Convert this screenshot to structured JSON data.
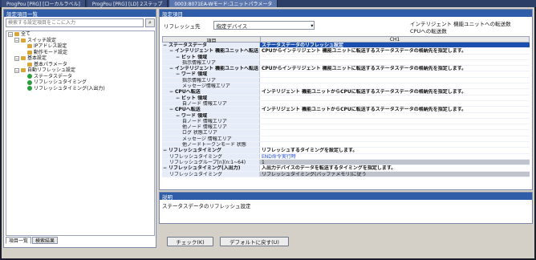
{
  "tabs": [
    {
      "label": "ProgPou [PRG] [ローカルラベル]"
    },
    {
      "label": "ProgPou [PRG] [LD] 2ステップ"
    },
    {
      "label": "0003:8071EA-Wモード:ユニットパラメータ"
    }
  ],
  "left": {
    "title": "設定項目一覧",
    "search_placeholder": "検索する設定項目をここに入力",
    "tree": [
      {
        "indent": 0,
        "toggle": "−",
        "icon": "gear",
        "label": "全て"
      },
      {
        "indent": 1,
        "toggle": "−",
        "icon": "folder",
        "label": "スイッチ設定"
      },
      {
        "indent": 2,
        "toggle": "",
        "icon": "folder",
        "label": "IPアドレス設定"
      },
      {
        "indent": 2,
        "toggle": "",
        "icon": "folder",
        "label": "動作モード設定"
      },
      {
        "indent": 1,
        "toggle": "−",
        "icon": "folder",
        "label": "基本設定"
      },
      {
        "indent": 2,
        "toggle": "",
        "icon": "folder",
        "label": "基本パラメータ"
      },
      {
        "indent": 1,
        "toggle": "−",
        "icon": "folder",
        "label": "自動リフレッシュ設定"
      },
      {
        "indent": 2,
        "toggle": "",
        "icon": "green",
        "label": "ステータスデータ"
      },
      {
        "indent": 2,
        "toggle": "",
        "icon": "green",
        "label": "リフレッシュタイミング"
      },
      {
        "indent": 2,
        "toggle": "",
        "icon": "green",
        "label": "リフレッシュタイミング(入出力)"
      }
    ],
    "tabs": [
      "項目一覧",
      "検索結果"
    ]
  },
  "right": {
    "title": "設定項目",
    "refresh_label": "リフレッシュ先",
    "refresh_value": "指定デバイス",
    "info1": "インテリジェント 機能ユニットへの転送数",
    "info2": "CPUへの転送数",
    "col_item": "項目",
    "col_ch": "CH1",
    "rows": [
      {
        "indent": 0,
        "toggle": "−",
        "item": "ステータスデータ",
        "value": "ステータスデータのリフレッシュ設定",
        "style": "selected",
        "bold": true
      },
      {
        "indent": 1,
        "toggle": "−",
        "item": "インテリジェント 機能ユニットへ転送",
        "value": "CPUからインテリジェント 機能ユニットに転送するステータスデータの格納先を指定します。",
        "style": "",
        "bold": true
      },
      {
        "indent": 2,
        "toggle": "−",
        "item": "ビット 領域",
        "value": "",
        "style": "",
        "bold": true
      },
      {
        "indent": 3,
        "toggle": "",
        "item": "指示情報エリア",
        "value": "",
        "style": "",
        "bold": false
      },
      {
        "indent": 1,
        "toggle": "−",
        "item": "インテリジェント 機能ユニットへ転送",
        "value": "CPUからインテリジェント 機能ユニットに転送するステータスデータの格納先を指定します。",
        "style": "",
        "bold": true
      },
      {
        "indent": 2,
        "toggle": "−",
        "item": "ワード 領域",
        "value": "",
        "style": "",
        "bold": true
      },
      {
        "indent": 3,
        "toggle": "",
        "item": "指示情報エリア",
        "value": "",
        "style": "",
        "bold": false
      },
      {
        "indent": 3,
        "toggle": "",
        "item": "メッセージ情報エリア",
        "value": "",
        "style": "",
        "bold": false
      },
      {
        "indent": 1,
        "toggle": "−",
        "item": "CPUへ転送",
        "value": "インテリジェント 機能ユニットからCPUに転送するステータスデータの格納先を指定します。",
        "style": "",
        "bold": true
      },
      {
        "indent": 2,
        "toggle": "−",
        "item": "ビット 領域",
        "value": "",
        "style": "",
        "bold": true
      },
      {
        "indent": 3,
        "toggle": "",
        "item": "自ノード 情報エリア",
        "value": "",
        "style": "",
        "bold": false
      },
      {
        "indent": 1,
        "toggle": "−",
        "item": "CPUへ転送",
        "value": "インテリジェント 機能ユニットからCPUに転送するステータスデータの格納先を指定します。",
        "style": "",
        "bold": true
      },
      {
        "indent": 2,
        "toggle": "−",
        "item": "ワード 領域",
        "value": "",
        "style": "",
        "bold": true
      },
      {
        "indent": 3,
        "toggle": "",
        "item": "自ノード 情報エリア",
        "value": "",
        "style": "",
        "bold": false
      },
      {
        "indent": 3,
        "toggle": "",
        "item": "他ノード 情報エリア",
        "value": "",
        "style": "",
        "bold": false
      },
      {
        "indent": 3,
        "toggle": "",
        "item": "ログ 状態エリア",
        "value": "",
        "style": "",
        "bold": false
      },
      {
        "indent": 3,
        "toggle": "",
        "item": "メッセージ 情報エリア",
        "value": "",
        "style": "",
        "bold": false
      },
      {
        "indent": 3,
        "toggle": "",
        "item": "他ノードトークンモード 状態",
        "value": "",
        "style": "",
        "bold": false
      },
      {
        "indent": 0,
        "toggle": "−",
        "item": "リフレッシュタイミング",
        "value": "リフレッシュするタイミングを設定します。",
        "style": "",
        "bold": true
      },
      {
        "indent": 1,
        "toggle": "",
        "item": "リフレッシュタイミング",
        "value": "END命令実行時",
        "style": "blue",
        "bold": false
      },
      {
        "indent": 1,
        "toggle": "",
        "item": "リフレッシュグループ[n](n:1~64)",
        "value": "1",
        "style": "gray",
        "bold": false
      },
      {
        "indent": 0,
        "toggle": "−",
        "item": "リフレッシュタイミング(入出力)",
        "value": "入出力デバイスのデータを転送するタイミングを指定します。",
        "style": "",
        "bold": true
      },
      {
        "indent": 1,
        "toggle": "",
        "item": "リフレッシュタイミング",
        "value": "リフレッシュタイミング(バッファメモリ)に従う",
        "style": "gray",
        "bold": false
      }
    ]
  },
  "desc": {
    "title": "説明",
    "text": "ステータスデータのリフレッシュ設定"
  },
  "buttons": {
    "check": "チェック(K)",
    "default": "デフォルトに戻す(U)"
  }
}
